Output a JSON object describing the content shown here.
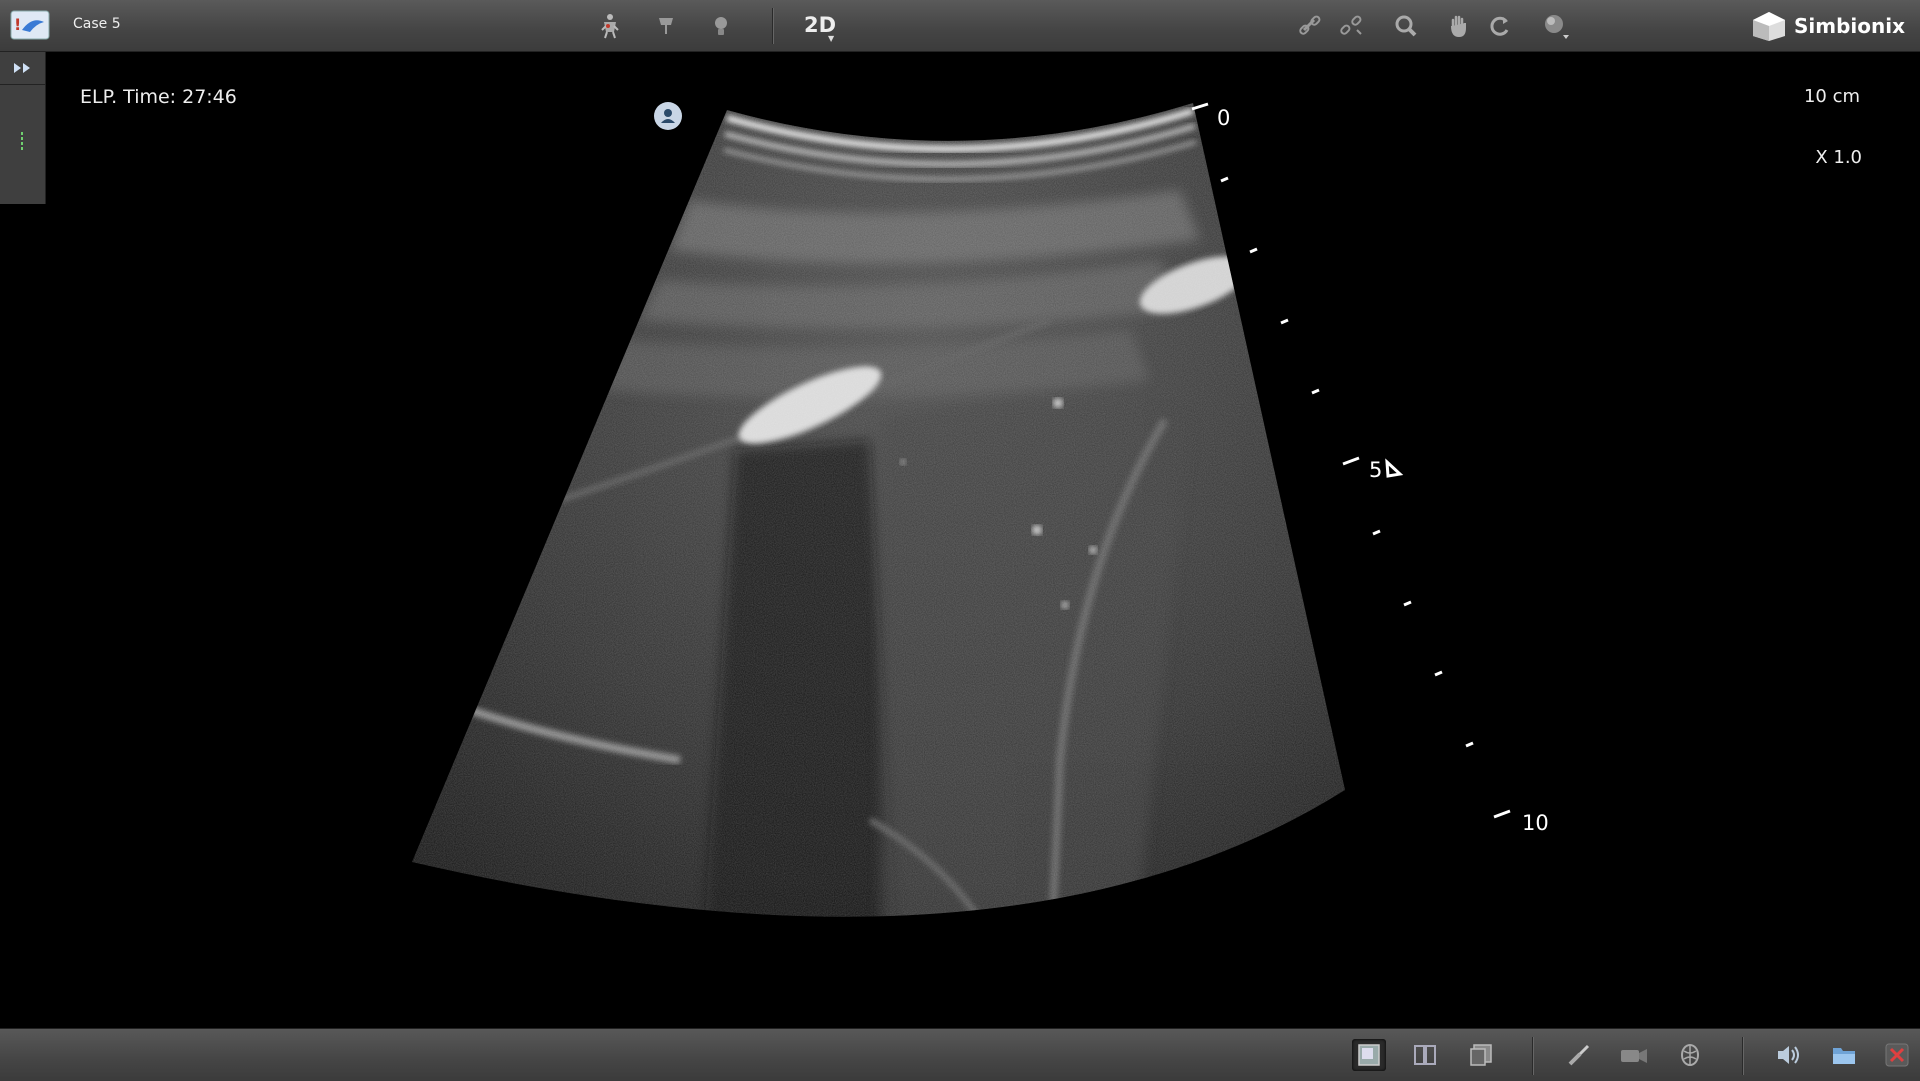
{
  "header": {
    "case_title": "Case 5",
    "mode": "2D",
    "brand": "Simbionix",
    "tools_left": [
      "anatomy-icon",
      "probe-icon",
      "lightbulb-icon"
    ],
    "tools_right": [
      "link-icon",
      "unlink-icon",
      "magnify-icon",
      "hand-icon",
      "rotate-icon",
      "sphere-icon"
    ]
  },
  "overlay": {
    "elp_time": "ELP. Time: 27:46",
    "depth": "10 cm",
    "zoom": "X 1.0"
  },
  "scale": {
    "label_top": "0",
    "label_mid": "5",
    "label_bottom": "10"
  },
  "footer": {
    "layout_buttons": [
      "single-view-icon",
      "dual-view-icon",
      "layered-view-icon"
    ],
    "tool_buttons": [
      "measure-icon",
      "camera-icon",
      "brain-icon"
    ],
    "system_buttons": [
      "speaker-icon",
      "folder-icon",
      "close-icon"
    ]
  },
  "colors": {
    "toolbar": "#4a4a4a",
    "background": "#000000",
    "accent_red": "#c0392b",
    "marker_green": "#6fcf6f"
  }
}
